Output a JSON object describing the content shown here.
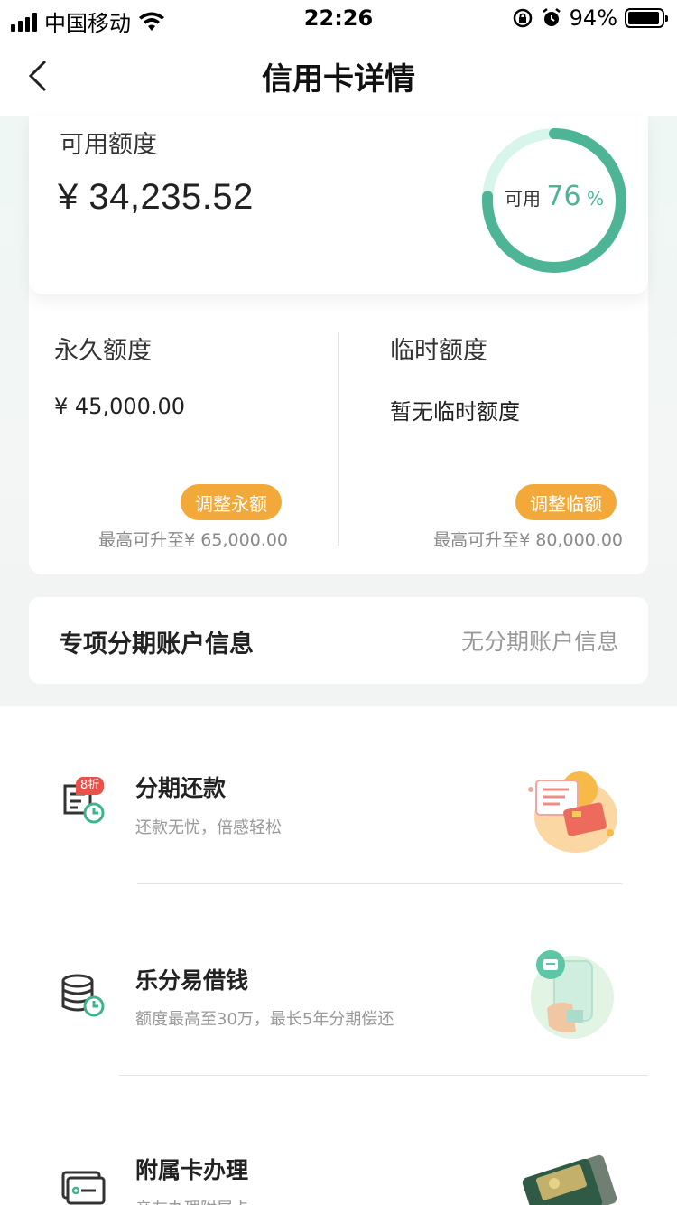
{
  "status_bar": {
    "carrier": "中国移动",
    "time": "22:26",
    "battery": "94%"
  },
  "nav": {
    "title": "信用卡详情"
  },
  "available": {
    "label": "可用额度",
    "amount": "¥ 34,235.52",
    "ring_label": "可用",
    "ring_percent": "76",
    "ring_percent_sign": "%",
    "ring_fraction": 0.76
  },
  "permanent": {
    "title": "永久额度",
    "value": "¥ 45,000.00",
    "button": "调整永额",
    "max_note": "最高可升至¥ 65,000.00"
  },
  "temporary": {
    "title": "临时额度",
    "value": "暂无临时额度",
    "button": "调整临额",
    "max_note": "最高可升至¥ 80,000.00"
  },
  "installment_account": {
    "title": "专项分期账户信息",
    "value": "无分期账户信息"
  },
  "services": [
    {
      "title": "分期还款",
      "desc": "还款无忧，倍感轻松",
      "badge": "8折",
      "icon": "installment-repay-icon"
    },
    {
      "title": "乐分易借钱",
      "desc": "额度最高至30万，最长5年分期偿还",
      "icon": "coin-stack-icon"
    },
    {
      "title": "附属卡办理",
      "desc": "亲友办理附属卡",
      "icon": "card-icon"
    }
  ],
  "colors": {
    "accent_green": "#4db596",
    "ring_track": "#d8f5ec",
    "button_orange": "#f3a93a",
    "badge_red": "#e8524a"
  }
}
